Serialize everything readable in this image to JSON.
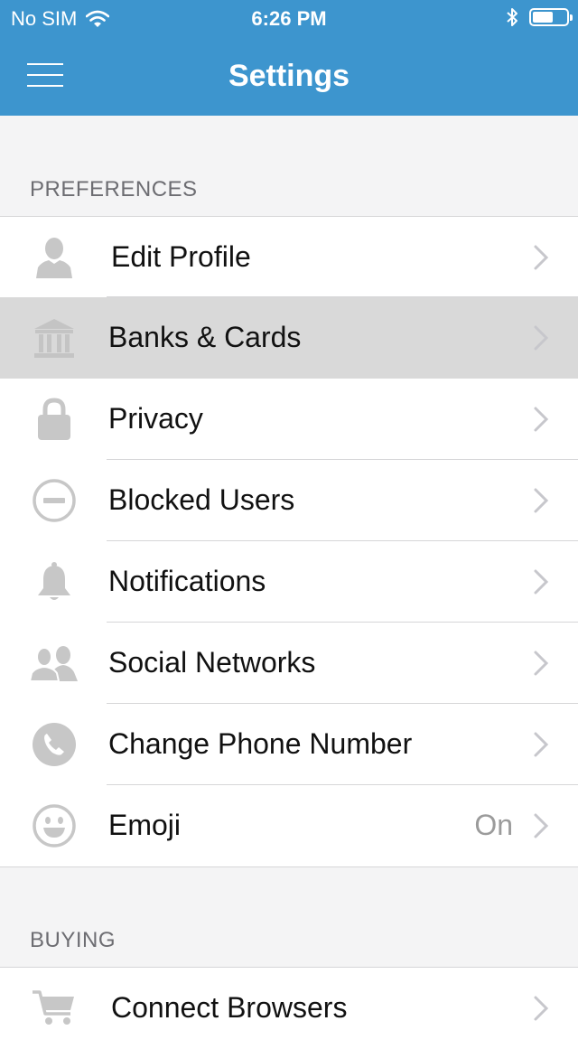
{
  "status_bar": {
    "carrier": "No SIM",
    "time": "6:26 PM"
  },
  "nav": {
    "title": "Settings"
  },
  "sections": {
    "preferences": {
      "header": "PREFERENCES",
      "items": [
        {
          "label": "Edit Profile",
          "icon": "person-icon"
        },
        {
          "label": "Banks & Cards",
          "icon": "bank-icon"
        },
        {
          "label": "Privacy",
          "icon": "lock-icon"
        },
        {
          "label": "Blocked Users",
          "icon": "blocked-icon"
        },
        {
          "label": "Notifications",
          "icon": "bell-icon"
        },
        {
          "label": "Social Networks",
          "icon": "people-icon"
        },
        {
          "label": "Change Phone Number",
          "icon": "phone-icon"
        },
        {
          "label": "Emoji",
          "value": "On",
          "icon": "emoji-icon"
        }
      ]
    },
    "buying": {
      "header": "BUYING",
      "items": [
        {
          "label": "Connect Browsers",
          "icon": "cart-icon"
        }
      ]
    }
  },
  "colors": {
    "nav_bar": "#3d95ce",
    "icon_gray": "#c7c7c7",
    "highlight_row": "#d9d9d9"
  }
}
